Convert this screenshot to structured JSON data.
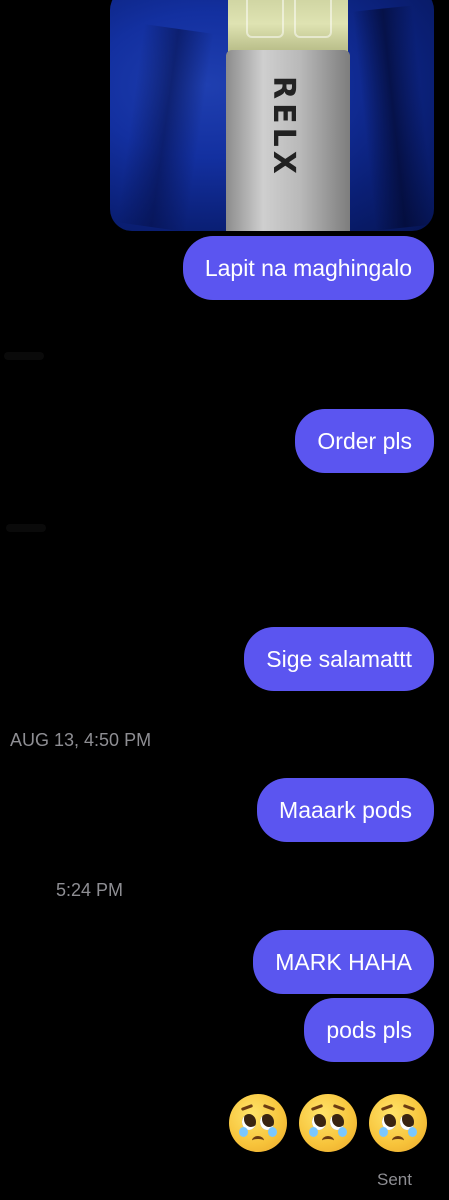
{
  "conversation": {
    "photo": {
      "brand_text": "RELX"
    },
    "messages": [
      {
        "text": "Lapit na maghingalo"
      },
      {
        "text": "Order pls"
      },
      {
        "text": "Sige salamattt"
      },
      {
        "text": "Maaark pods"
      },
      {
        "text": "MARK HAHA"
      },
      {
        "text": "pods pls"
      }
    ],
    "timestamps": [
      {
        "text": "AUG 13, 4:50 PM"
      },
      {
        "text": "5:24 PM"
      }
    ],
    "reaction_emojis": [
      "pleading-face-with-tears-icon",
      "pleading-face-with-tears-icon",
      "pleading-face-with-tears-icon"
    ],
    "status": "Sent",
    "colors": {
      "bubble": "#5b55f0",
      "background": "#000000",
      "timestamp": "#8e8e93"
    }
  }
}
